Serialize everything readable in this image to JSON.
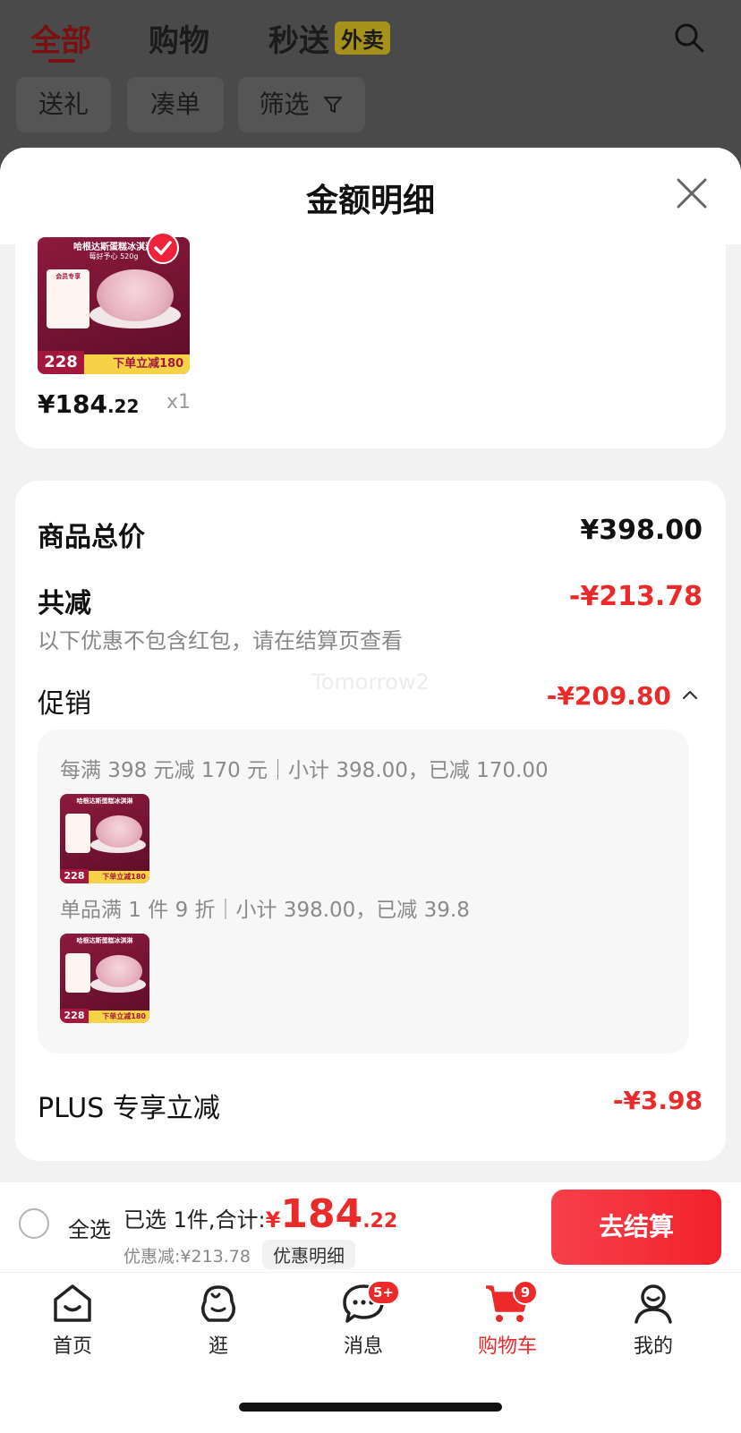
{
  "header": {
    "tabs": [
      {
        "label": "全部",
        "active": true
      },
      {
        "label": "购物",
        "active": false
      },
      {
        "label": "秒送",
        "active": false,
        "badge": "外卖"
      }
    ],
    "search_icon": "search-icon",
    "chips": [
      {
        "label": "送礼"
      },
      {
        "label": "凑单"
      },
      {
        "label": "筛选",
        "icon": "filter-icon"
      }
    ]
  },
  "sheet": {
    "title": "金额明细",
    "close_icon": "close-icon"
  },
  "product": {
    "image": {
      "title": "哈根达斯蛋糕冰淇淋",
      "subtitle": "莓好予心 520g",
      "member_tag": "会员专享",
      "big_price": "228",
      "deal": "下单立减180"
    },
    "price_main": "¥184",
    "price_decimal": ".22",
    "quantity": "x1",
    "selected": true
  },
  "summary": {
    "total_label": "商品总价",
    "total_value": "¥398.00",
    "reduce_label": "共减",
    "reduce_value": "-¥213.78",
    "note": "以下优惠不包含红包，请在结算页查看",
    "watermark": "Tomorrow2",
    "promo_label": "促销",
    "promo_value": "-¥209.80",
    "promo_rules": [
      {
        "text": "每满 398 元减 170 元｜小计 398.00，已减 170.00"
      },
      {
        "text": "单品满 1 件 9 折｜小计 398.00，已减 39.8"
      }
    ],
    "plus_label": "PLUS 专享立减",
    "plus_value": "-¥3.98"
  },
  "bottom_bar": {
    "select_all": "全选",
    "selected_text": "已选 1件,合计:",
    "currency": "¥",
    "total_int": "184",
    "total_dec": ".22",
    "discount_text": "优惠减:¥213.78",
    "detail_button": "优惠明细",
    "checkout_button": "去结算"
  },
  "tab_bar": {
    "items": [
      {
        "label": "首页",
        "icon": "home-icon"
      },
      {
        "label": "逛",
        "icon": "browse-icon"
      },
      {
        "label": "消息",
        "icon": "message-icon",
        "badge": "5+"
      },
      {
        "label": "购物车",
        "icon": "cart-icon",
        "badge": "9",
        "active": true
      },
      {
        "label": "我的",
        "icon": "profile-icon"
      }
    ]
  },
  "colors": {
    "accent_red": "#ec2a2a",
    "active_tab_dark": "#7a1010",
    "badge_yellow": "#a6911a",
    "product_bg": "#8d1a3e"
  }
}
